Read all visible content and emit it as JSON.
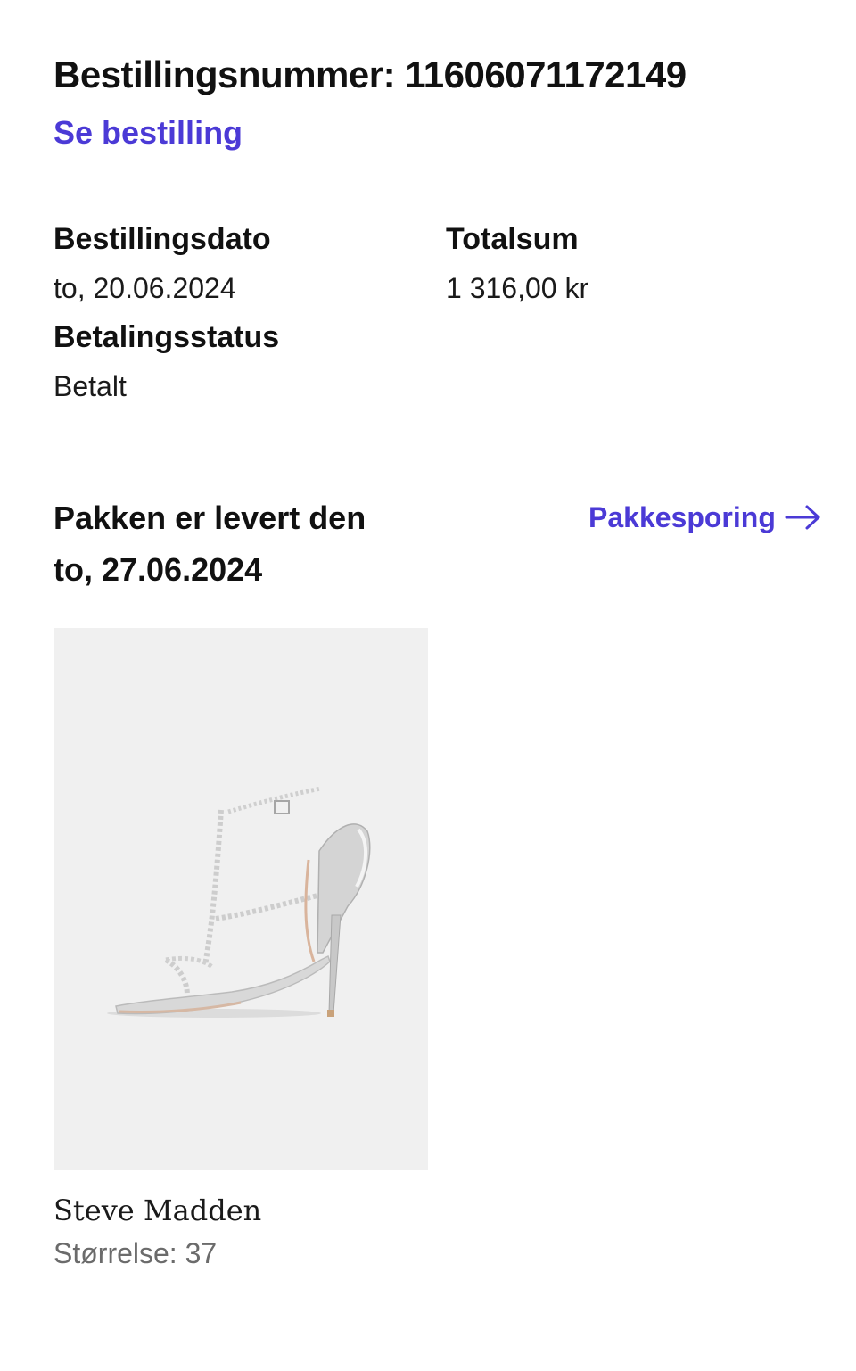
{
  "order": {
    "number_label": "Bestillingsnummer: 11606071172149",
    "view_link": "Se bestilling"
  },
  "details": {
    "date_label": "Bestillingsdato",
    "date_value": "to, 20.06.2024",
    "total_label": "Totalsum",
    "total_value": "1 316,00 kr",
    "payment_label": "Betalingsstatus",
    "payment_value": "Betalt"
  },
  "delivery": {
    "status_line1": "Pakken er levert den",
    "status_line2": "to, 27.06.2024",
    "tracking_link": "Pakkesporing",
    "tracking_icon": "arrow-right-icon"
  },
  "product": {
    "image_subject": "silver-crystal-strap-stiletto-sandal",
    "brand": "Steve Madden",
    "size_label": "Størrelse: 37"
  },
  "colors": {
    "accent": "#4b3ad6",
    "text": "#111111",
    "muted": "#6b6b6b",
    "image_bg": "#f0f0f0"
  }
}
